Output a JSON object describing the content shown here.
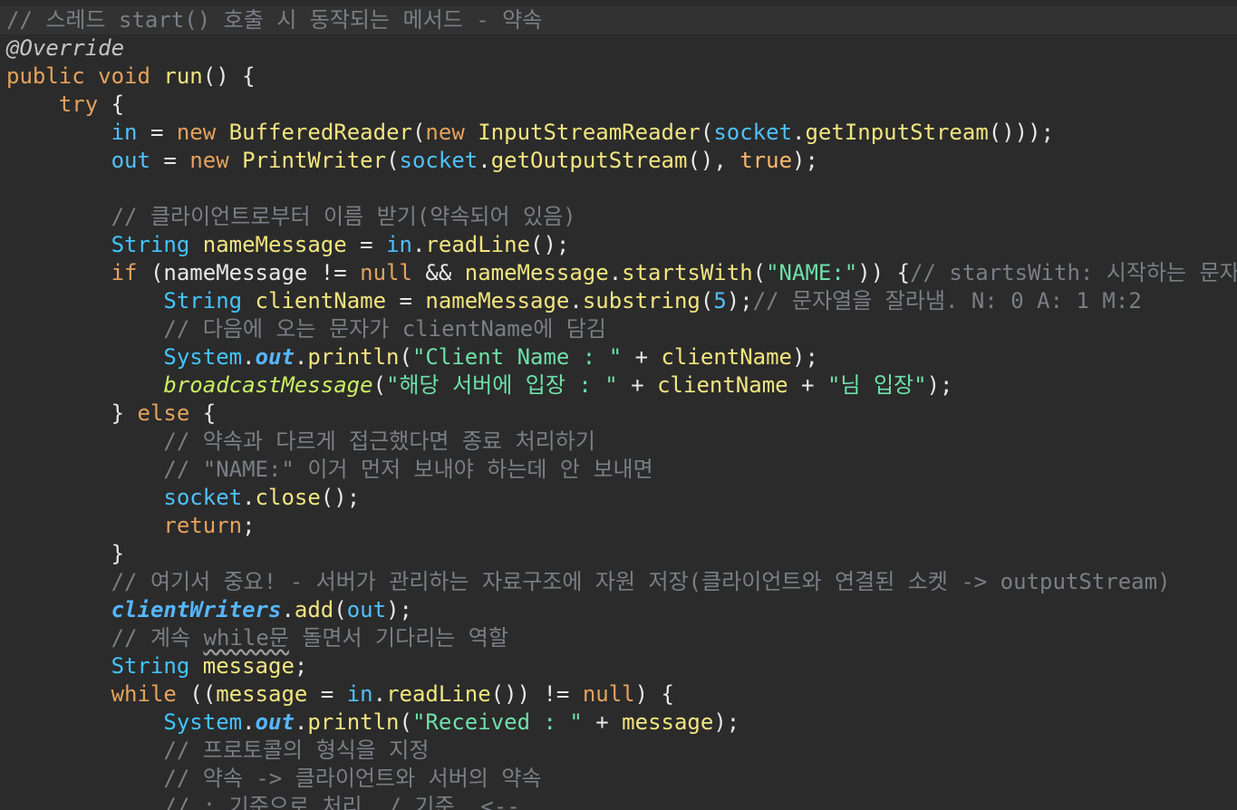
{
  "editor": {
    "language": "Java",
    "theme": "dark",
    "background": "#2b2b2b",
    "lines": [
      [
        {
          "t": "// 스레드 start() 호출 시 동작되는 메서드 - 약속",
          "c": "c"
        }
      ],
      [
        {
          "t": "@Override",
          "c": "a"
        }
      ],
      [
        {
          "t": "public",
          "c": "k"
        },
        {
          "t": " ",
          "c": "t"
        },
        {
          "t": "void",
          "c": "k"
        },
        {
          "t": " ",
          "c": "t"
        },
        {
          "t": "run",
          "c": "f"
        },
        {
          "t": "() {",
          "c": "t"
        }
      ],
      [
        {
          "t": "    ",
          "c": "t"
        },
        {
          "t": "try",
          "c": "k"
        },
        {
          "t": " {",
          "c": "t"
        }
      ],
      [
        {
          "t": "        ",
          "c": "t"
        },
        {
          "t": "in",
          "c": "p"
        },
        {
          "t": " = ",
          "c": "t"
        },
        {
          "t": "new",
          "c": "k"
        },
        {
          "t": " ",
          "c": "t"
        },
        {
          "t": "BufferedReader",
          "c": "v"
        },
        {
          "t": "(",
          "c": "t"
        },
        {
          "t": "new",
          "c": "k"
        },
        {
          "t": " ",
          "c": "t"
        },
        {
          "t": "InputStreamReader",
          "c": "v"
        },
        {
          "t": "(",
          "c": "t"
        },
        {
          "t": "socket",
          "c": "p"
        },
        {
          "t": ".",
          "c": "t"
        },
        {
          "t": "getInputStream",
          "c": "v"
        },
        {
          "t": "()));",
          "c": "t"
        }
      ],
      [
        {
          "t": "        ",
          "c": "t"
        },
        {
          "t": "out",
          "c": "p"
        },
        {
          "t": " = ",
          "c": "t"
        },
        {
          "t": "new",
          "c": "k"
        },
        {
          "t": " ",
          "c": "t"
        },
        {
          "t": "PrintWriter",
          "c": "v"
        },
        {
          "t": "(",
          "c": "t"
        },
        {
          "t": "socket",
          "c": "p"
        },
        {
          "t": ".",
          "c": "t"
        },
        {
          "t": "getOutputStream",
          "c": "v"
        },
        {
          "t": "(), ",
          "c": "t"
        },
        {
          "t": "true",
          "c": "ok"
        },
        {
          "t": ");",
          "c": "t"
        }
      ],
      [
        {
          "t": "",
          "c": "t"
        }
      ],
      [
        {
          "t": "        ",
          "c": "t"
        },
        {
          "t": "// 클라이언트로부터 이름 받기(약속되어 있음)",
          "c": "c"
        }
      ],
      [
        {
          "t": "        ",
          "c": "t"
        },
        {
          "t": "String",
          "c": "ty"
        },
        {
          "t": " ",
          "c": "t"
        },
        {
          "t": "nameMessage",
          "c": "v"
        },
        {
          "t": " = ",
          "c": "t"
        },
        {
          "t": "in",
          "c": "p"
        },
        {
          "t": ".",
          "c": "t"
        },
        {
          "t": "readLine",
          "c": "v"
        },
        {
          "t": "();",
          "c": "t"
        }
      ],
      [
        {
          "t": "        ",
          "c": "t"
        },
        {
          "t": "if",
          "c": "k"
        },
        {
          "t": " (",
          "c": "t"
        },
        {
          "t": "nameMessage",
          "c": "t"
        },
        {
          "t": " != ",
          "c": "t"
        },
        {
          "t": "null",
          "c": "k"
        },
        {
          "t": " && ",
          "c": "t"
        },
        {
          "t": "nameMessage",
          "c": "v"
        },
        {
          "t": ".",
          "c": "t"
        },
        {
          "t": "startsWith",
          "c": "v"
        },
        {
          "t": "(",
          "c": "t"
        },
        {
          "t": "\"NAME:\"",
          "c": "s"
        },
        {
          "t": ")) {",
          "c": "t"
        },
        {
          "t": "// startsWith: 시작하는 문자열이",
          "c": "c"
        }
      ],
      [
        {
          "t": "            ",
          "c": "t"
        },
        {
          "t": "String",
          "c": "ty"
        },
        {
          "t": " ",
          "c": "t"
        },
        {
          "t": "clientName",
          "c": "v"
        },
        {
          "t": " = ",
          "c": "t"
        },
        {
          "t": "nameMessage",
          "c": "v"
        },
        {
          "t": ".",
          "c": "t"
        },
        {
          "t": "substring",
          "c": "v"
        },
        {
          "t": "(",
          "c": "t"
        },
        {
          "t": "5",
          "c": "y"
        },
        {
          "t": ");",
          "c": "t"
        },
        {
          "t": "// 문자열을 잘라냄. N: 0 A: 1 M:2",
          "c": "c"
        }
      ],
      [
        {
          "t": "            ",
          "c": "t"
        },
        {
          "t": "// 다음에 오는 문자가 clientName에 담김",
          "c": "c"
        }
      ],
      [
        {
          "t": "            ",
          "c": "t"
        },
        {
          "t": "System",
          "c": "ty"
        },
        {
          "t": ".",
          "c": "t"
        },
        {
          "t": "out",
          "c": "sf"
        },
        {
          "t": ".",
          "c": "t"
        },
        {
          "t": "println",
          "c": "v"
        },
        {
          "t": "(",
          "c": "t"
        },
        {
          "t": "\"Client Name : \"",
          "c": "s"
        },
        {
          "t": " + ",
          "c": "t"
        },
        {
          "t": "clientName",
          "c": "v"
        },
        {
          "t": ");",
          "c": "t"
        }
      ],
      [
        {
          "t": "            ",
          "c": "t"
        },
        {
          "t": "broadcastMessage",
          "c": "i"
        },
        {
          "t": "(",
          "c": "t"
        },
        {
          "t": "\"해당 서버에 입장 : \"",
          "c": "s"
        },
        {
          "t": " + ",
          "c": "t"
        },
        {
          "t": "clientName",
          "c": "v"
        },
        {
          "t": " + ",
          "c": "t"
        },
        {
          "t": "\"님 입장\"",
          "c": "s"
        },
        {
          "t": ");",
          "c": "t"
        }
      ],
      [
        {
          "t": "        } ",
          "c": "t"
        },
        {
          "t": "else",
          "c": "k"
        },
        {
          "t": " {",
          "c": "t"
        }
      ],
      [
        {
          "t": "            ",
          "c": "t"
        },
        {
          "t": "// 약속과 다르게 접근했다면 종료 처리하기",
          "c": "c"
        }
      ],
      [
        {
          "t": "            ",
          "c": "t"
        },
        {
          "t": "// \"NAME:\" 이거 먼저 보내야 하는데 안 보내면",
          "c": "c"
        }
      ],
      [
        {
          "t": "            ",
          "c": "t"
        },
        {
          "t": "socket",
          "c": "p"
        },
        {
          "t": ".",
          "c": "t"
        },
        {
          "t": "close",
          "c": "v"
        },
        {
          "t": "();",
          "c": "t"
        }
      ],
      [
        {
          "t": "            ",
          "c": "t"
        },
        {
          "t": "return",
          "c": "k"
        },
        {
          "t": ";",
          "c": "t"
        }
      ],
      [
        {
          "t": "        }",
          "c": "t"
        }
      ],
      [
        {
          "t": "        ",
          "c": "t"
        },
        {
          "t": "// 여기서 중요! - 서버가 관리하는 자료구조에 자원 저장(클라이언트와 연결된 소켓 -> outputStream)",
          "c": "c"
        }
      ],
      [
        {
          "t": "        ",
          "c": "t"
        },
        {
          "t": "clientWriters",
          "c": "sf"
        },
        {
          "t": ".",
          "c": "t"
        },
        {
          "t": "add",
          "c": "v"
        },
        {
          "t": "(",
          "c": "t"
        },
        {
          "t": "out",
          "c": "p"
        },
        {
          "t": ");",
          "c": "t"
        }
      ],
      [
        {
          "t": "        ",
          "c": "t"
        },
        {
          "t": "// 계속 ",
          "c": "c"
        },
        {
          "t": "while문",
          "c": "c",
          "u": true
        },
        {
          "t": " 돌면서 기다리는 역할",
          "c": "c"
        }
      ],
      [
        {
          "t": "        ",
          "c": "t"
        },
        {
          "t": "String",
          "c": "ty"
        },
        {
          "t": " ",
          "c": "t"
        },
        {
          "t": "message",
          "c": "v"
        },
        {
          "t": ";",
          "c": "t"
        }
      ],
      [
        {
          "t": "        ",
          "c": "t"
        },
        {
          "t": "while",
          "c": "k"
        },
        {
          "t": " ((",
          "c": "t"
        },
        {
          "t": "message",
          "c": "v"
        },
        {
          "t": " = ",
          "c": "t"
        },
        {
          "t": "in",
          "c": "p"
        },
        {
          "t": ".",
          "c": "t"
        },
        {
          "t": "readLine",
          "c": "v"
        },
        {
          "t": "()) != ",
          "c": "t"
        },
        {
          "t": "null",
          "c": "k"
        },
        {
          "t": ") {",
          "c": "t"
        }
      ],
      [
        {
          "t": "            ",
          "c": "t"
        },
        {
          "t": "System",
          "c": "ty"
        },
        {
          "t": ".",
          "c": "t"
        },
        {
          "t": "out",
          "c": "sf"
        },
        {
          "t": ".",
          "c": "t"
        },
        {
          "t": "println",
          "c": "v"
        },
        {
          "t": "(",
          "c": "t"
        },
        {
          "t": "\"Received : \"",
          "c": "s"
        },
        {
          "t": " + ",
          "c": "t"
        },
        {
          "t": "message",
          "c": "v"
        },
        {
          "t": ");",
          "c": "t"
        }
      ],
      [
        {
          "t": "            ",
          "c": "t"
        },
        {
          "t": "// 프로토콜의 형식을 지정",
          "c": "c"
        }
      ],
      [
        {
          "t": "            ",
          "c": "t"
        },
        {
          "t": "// 약속 -> 클라이언트와 서버의 약속",
          "c": "c"
        }
      ],
      [
        {
          "t": "            ",
          "c": "t"
        },
        {
          "t": "// : 기준으로 처리, / 기준, <--",
          "c": "c"
        }
      ]
    ]
  }
}
